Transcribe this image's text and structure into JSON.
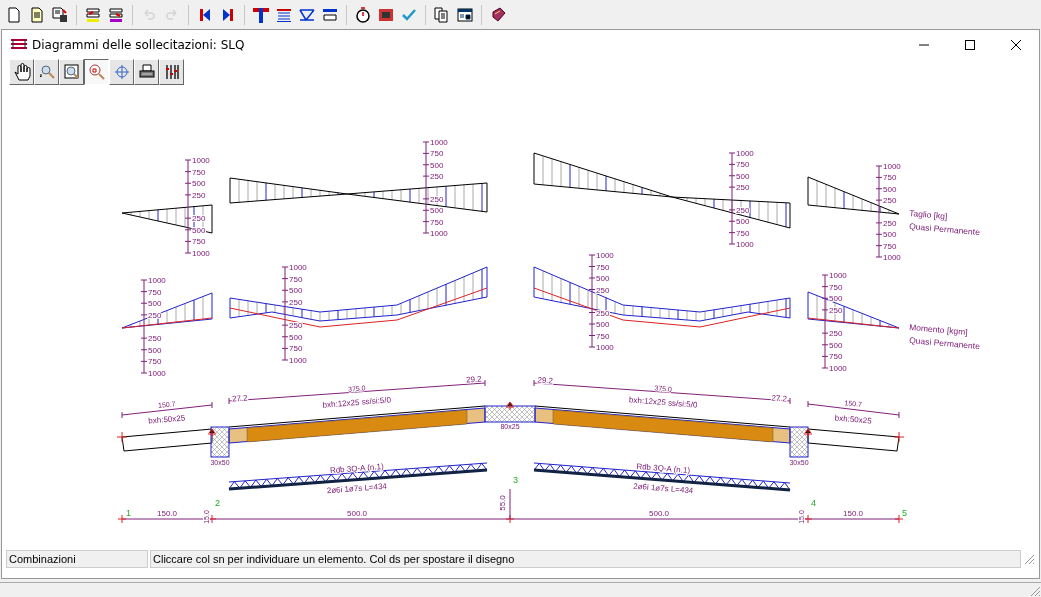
{
  "app_toolbar": {
    "groups": [
      [
        {
          "disabled": false
        },
        {
          "disabled": false
        },
        {
          "disabled": false
        }
      ],
      [
        {
          "disabled": false
        },
        {
          "disabled": false
        }
      ],
      [
        {
          "disabled": true
        },
        {
          "disabled": true
        }
      ],
      [
        {
          "disabled": false
        },
        {
          "disabled": false
        }
      ],
      [
        {
          "disabled": false
        },
        {
          "disabled": false
        },
        {
          "disabled": false
        },
        {
          "disabled": false
        }
      ],
      [
        {
          "disabled": false
        },
        {
          "disabled": false
        },
        {
          "disabled": false
        }
      ],
      [
        {
          "disabled": false
        },
        {
          "disabled": false
        }
      ],
      [
        {
          "disabled": false
        }
      ]
    ]
  },
  "window": {
    "title": "Diagrammi delle sollecitazioni: SLQ"
  },
  "view_toolbar": [
    {
      "selected": false
    },
    {
      "selected": false
    },
    {
      "selected": false
    },
    {
      "selected": true
    },
    {
      "selected": false
    },
    {
      "selected": false
    },
    {
      "selected": false
    }
  ],
  "diagram": {
    "scales": [
      {
        "labels": [
          "1000",
          "750",
          "500",
          "250",
          "250",
          "500",
          "750",
          "1000"
        ]
      },
      {
        "labels": [
          "1000",
          "750",
          "500",
          "250",
          "250",
          "500",
          "750",
          "1000"
        ]
      },
      {
        "labels": [
          "1000",
          "750",
          "500",
          "250",
          "250",
          "500",
          "750",
          "1000"
        ]
      },
      {
        "labels": [
          "1000",
          "750",
          "500",
          "250",
          "250",
          "500",
          "750",
          "1000"
        ]
      },
      {
        "labels": [
          "1000",
          "750",
          "500",
          "250",
          "250",
          "500",
          "750",
          "1000"
        ]
      },
      {
        "labels": [
          "1000",
          "750",
          "500",
          "250",
          "250",
          "500",
          "750",
          "1000"
        ]
      },
      {
        "labels": [
          "1000",
          "750",
          "500",
          "250",
          "250",
          "500",
          "750",
          "1000"
        ]
      },
      {
        "labels": [
          "1000",
          "750",
          "500",
          "250",
          "250",
          "500",
          "750",
          "1000"
        ]
      }
    ],
    "legends": [
      {
        "title": "Taglio [kg]",
        "subtitle": "Quasi Permanente"
      },
      {
        "title": "Momento [kgm]",
        "subtitle": "Quasi Permanente"
      }
    ],
    "cantilevers": [
      {
        "length": "150.7",
        "section": "bxh:50x25"
      },
      {
        "length": "150.7",
        "section": "bxh:50x25"
      }
    ],
    "slabs": [
      {
        "start": "27.2",
        "length": "375.0",
        "end": "29.2",
        "section": "bxh:12x25 ss/si:5/0",
        "joist": "Rdb 3Q-A (n.1)",
        "rebar": "2ø6i 1ø7s L=434"
      },
      {
        "start": "29.2",
        "length": "375.0",
        "end": "27.2",
        "section": "bxh:12x25 ss/si:5/0",
        "joist": "Rdb 3Q-A (n.1)",
        "rebar": "2ø6i 1ø7s L=434"
      }
    ],
    "supports": [
      "30x50",
      "80x25",
      "30x50"
    ],
    "nodes": [
      "1",
      "2",
      "3",
      "4",
      "5"
    ],
    "spans": [
      "150.0",
      "500.0",
      "500.0",
      "150.0"
    ],
    "heights": [
      "15.0",
      "55.0",
      "15.0"
    ]
  },
  "status_bar": {
    "panel": "Combinazioni",
    "message": "Cliccare col sn per individuare un elemento. Col ds per spostare il disegno"
  }
}
